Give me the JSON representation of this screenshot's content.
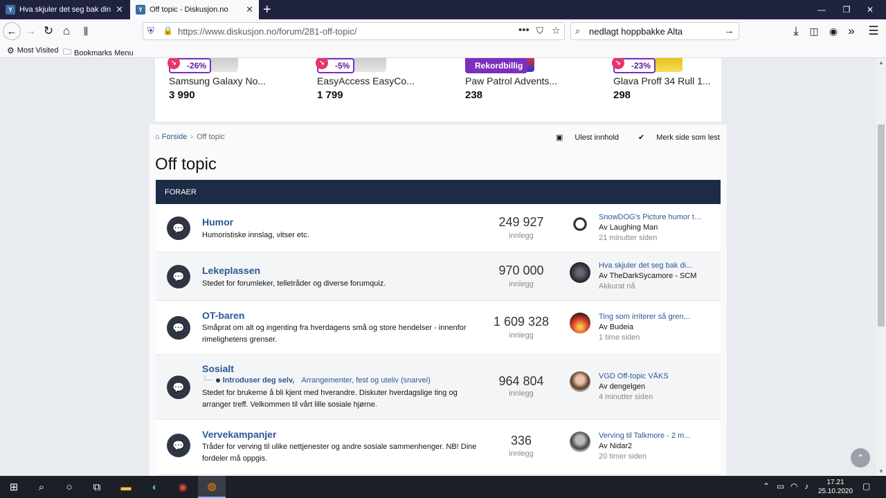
{
  "browser": {
    "tabs": [
      {
        "title": "Hva skjuler det seg bak din Ctrl",
        "favicon": "diskusjon-icon"
      },
      {
        "title": "Off topic - Diskusjon.no",
        "favicon": "diskusjon-icon"
      }
    ],
    "url": "https://www.diskusjon.no/forum/281-off-topic/",
    "search_query": "nedlagt hoppbakke Alta",
    "bookmarks": [
      "Most Visited",
      "Bookmarks Menu"
    ]
  },
  "ads": [
    {
      "badge": "-26%",
      "name": "Samsung Galaxy No...",
      "price": "3 990"
    },
    {
      "badge": "-5%",
      "name": "EasyAccess EasyCo...",
      "price": "1 799"
    },
    {
      "badge": "Rekordbillig",
      "name": "Paw Patrol Advents...",
      "price": "238"
    },
    {
      "badge": "-23%",
      "name": "Glava Proff 34 Rull 1...",
      "price": "298"
    }
  ],
  "breadcrumb": {
    "home": "Forside",
    "current": "Off topic"
  },
  "toplinks": {
    "unread": "Ulest innhold",
    "mark_read": "Merk side som lest"
  },
  "page_title": "Off topic",
  "block_header": "FORAER",
  "forums": [
    {
      "title": "Humor",
      "desc": "Humoristiske innslag, vitser etc.",
      "count": "249 927",
      "count_label": "innlegg",
      "last_title": "SnowDOG's Picture humor th...",
      "last_user": "Av Laughing Man",
      "last_when": "21 minutter siden"
    },
    {
      "title": "Lekeplassen",
      "desc": "Stedet for forumleker, telletråder og diverse forumquiz.",
      "count": "970 000",
      "count_label": "innlegg",
      "last_title": "Hva skjuler det seg bak di...",
      "last_user": "Av TheDarkSycamore - SCM",
      "last_when": "Akkurat nå"
    },
    {
      "title": "OT-baren",
      "desc": "Småprat om alt og ingenting fra hverdagens små og store hendelser - innenfor rimelighetens grenser.",
      "count": "1 609 328",
      "count_label": "innlegg",
      "last_title": "Ting som irriterer så gren...",
      "last_user": "Av Budeia",
      "last_when": "1 time siden"
    },
    {
      "title": "Sosialt",
      "sub1": "Introduser deg selv,",
      "sub2": "Arrangementer, fest og uteliv (snarvei)",
      "desc": "Stedet for brukerne å bli kjent med hverandre. Diskuter hverdagslige ting og arranger treff. Velkommen til vårt lille sosiale hjørne.",
      "count": "964 804",
      "count_label": "innlegg",
      "last_title": "VGD Off-topic VÅKS",
      "last_user": "Av dengelgen",
      "last_when": "4 minutter siden"
    },
    {
      "title": "Vervekampanjer",
      "desc": "Tråder for verving til ulike nettjenester og andre sosiale sammenhenger. NB! Dine fordeler må oppgis.",
      "count": "336",
      "count_label": "innlegg",
      "last_title": "Verving til Talkmore - 2 m...",
      "last_user": "Av Nidar2",
      "last_when": "20 timer siden"
    }
  ],
  "clock": {
    "time": "17.21",
    "date": "25.10.2020"
  },
  "colors": {
    "header_bg": "#1d2b45",
    "link": "#2b5796",
    "tab_bar": "#202340",
    "ad_badge": "#7b2fbe"
  }
}
